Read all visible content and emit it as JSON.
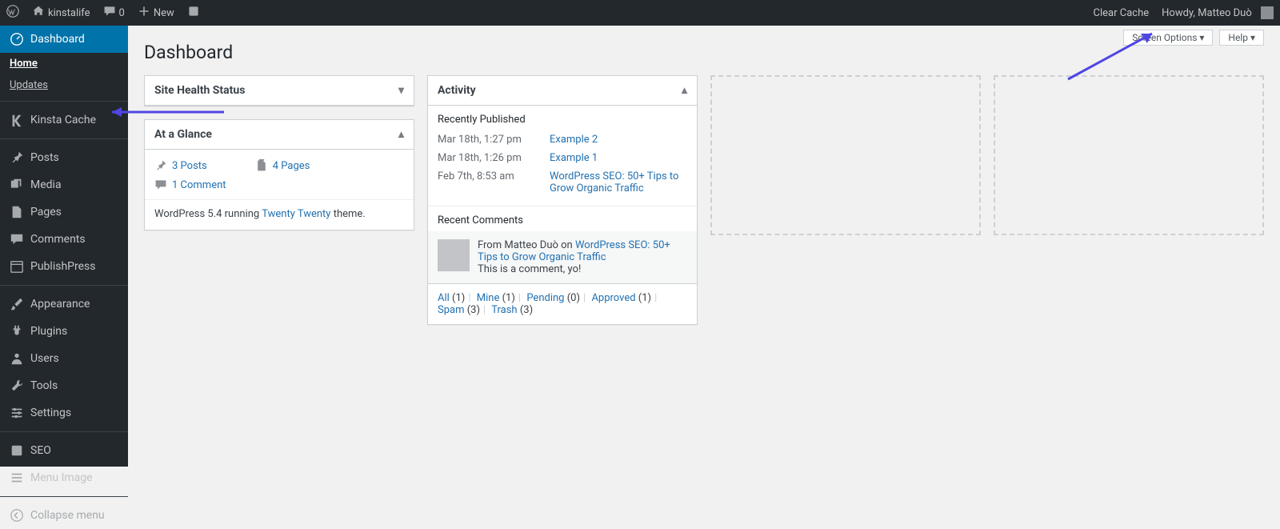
{
  "topbar": {
    "site": "kinstalife",
    "comments": "0",
    "new": "New",
    "clearcache": "Clear Cache",
    "howdy": "Howdy, Matteo Duò"
  },
  "topctrl": {
    "screen": "Screen Options",
    "help": "Help"
  },
  "sidebar": {
    "dashboard": "Dashboard",
    "subs": [
      "Home",
      "Updates"
    ],
    "kinsta": "Kinsta Cache",
    "posts": "Posts",
    "media": "Media",
    "pages": "Pages",
    "comments": "Comments",
    "pp": "PublishPress",
    "appearance": "Appearance",
    "plugins": "Plugins",
    "users": "Users",
    "tools": "Tools",
    "settings": "Settings",
    "seo": "SEO",
    "menuimg": "Menu Image",
    "collapse": "Collapse menu"
  },
  "heading": "Dashboard",
  "box": {
    "health": "Site Health Status",
    "glance": "At a Glance",
    "activity": "Activity"
  },
  "glance": {
    "posts": "3 Posts",
    "pages": "4 Pages",
    "comment": "1 Comment",
    "ver_pre": "WordPress 5.4 running ",
    "theme": "Twenty Twenty",
    "ver_post": " theme."
  },
  "activity": {
    "pub": "Recently Published",
    "items": [
      {
        "t": "Mar 18th, 1:27 pm",
        "l": "Example 2"
      },
      {
        "t": "Mar 18th, 1:26 pm",
        "l": "Example 1"
      },
      {
        "t": "Feb 7th, 8:53 am",
        "l": "WordPress SEO: 50+ Tips to Grow Organic Traffic"
      }
    ],
    "recent": "Recent Comments",
    "cmt_from": "From Matteo Duò on ",
    "cmt_link": "WordPress SEO: 50+ Tips to Grow Organic Traffic",
    "cmt_body": "This is a comment, yo!",
    "filters": [
      {
        "l": "All",
        "n": "(1)"
      },
      {
        "l": "Mine",
        "n": "(1)"
      },
      {
        "l": "Pending",
        "n": "(0)"
      },
      {
        "l": "Approved",
        "n": "(1)"
      },
      {
        "l": "Spam",
        "n": "(3)"
      },
      {
        "l": "Trash",
        "n": "(3)"
      }
    ]
  }
}
